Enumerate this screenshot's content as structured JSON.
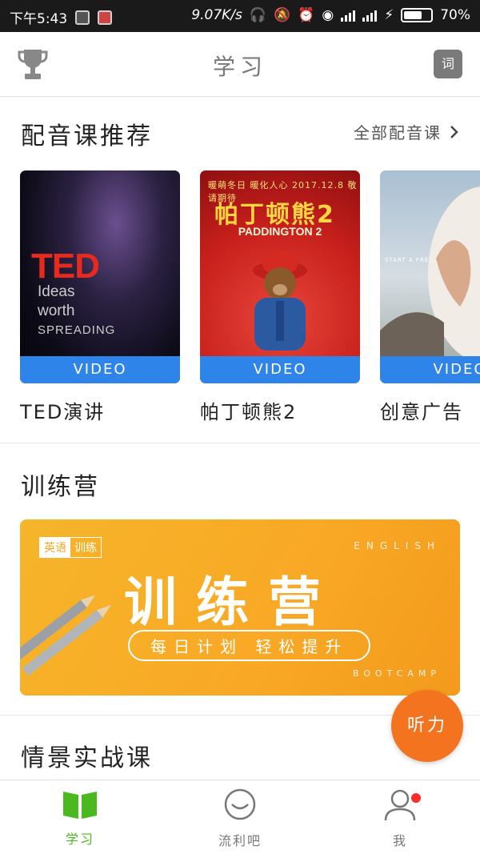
{
  "status_bar": {
    "time": "下午5:43",
    "net_speed": "9.07K/s",
    "battery": "70%"
  },
  "header": {
    "title": "学习",
    "dict_icon_label": "词",
    "left_icon": "trophy-icon"
  },
  "dubbing": {
    "title": "配音课推荐",
    "see_all": "全部配音课",
    "cards": [
      {
        "badge": "VIDEO",
        "label": "TED演讲",
        "thumb_logo": "TED",
        "thumb_line1": "Ideas",
        "thumb_line2": "worth",
        "thumb_line3": "SPREADING"
      },
      {
        "badge": "VIDEO",
        "label": "帕丁顿熊2",
        "thumb_top": "暖萌冬日 暖化人心 2017.12.8 敬请期待",
        "thumb_title": "帕丁顿熊2",
        "thumb_sub": "PADDINGTON 2"
      },
      {
        "badge": "VIDEO",
        "label": "创意广告",
        "thumb_caption": "START A FRESH LIFE"
      }
    ]
  },
  "bootcamp": {
    "title": "训练营",
    "banner": {
      "tag_a": "英语",
      "tag_b": "训练",
      "english": "ENGLISH",
      "headline": "训练营",
      "slogan": "每日计划 轻松提升",
      "footer": "BOOTCAMP"
    }
  },
  "scenario": {
    "title": "情景实战课"
  },
  "floating_button": "听力",
  "bottom_nav": [
    {
      "label": "学习",
      "icon": "book-icon",
      "active": true
    },
    {
      "label": "流利吧",
      "icon": "smile-bubble-icon",
      "active": false
    },
    {
      "label": "我",
      "icon": "person-icon",
      "active": false
    }
  ],
  "colors": {
    "active_nav": "#4cb81f",
    "video_bar": "#2e84e8",
    "float_button": "#f4731e",
    "banner": "#f9a825"
  }
}
